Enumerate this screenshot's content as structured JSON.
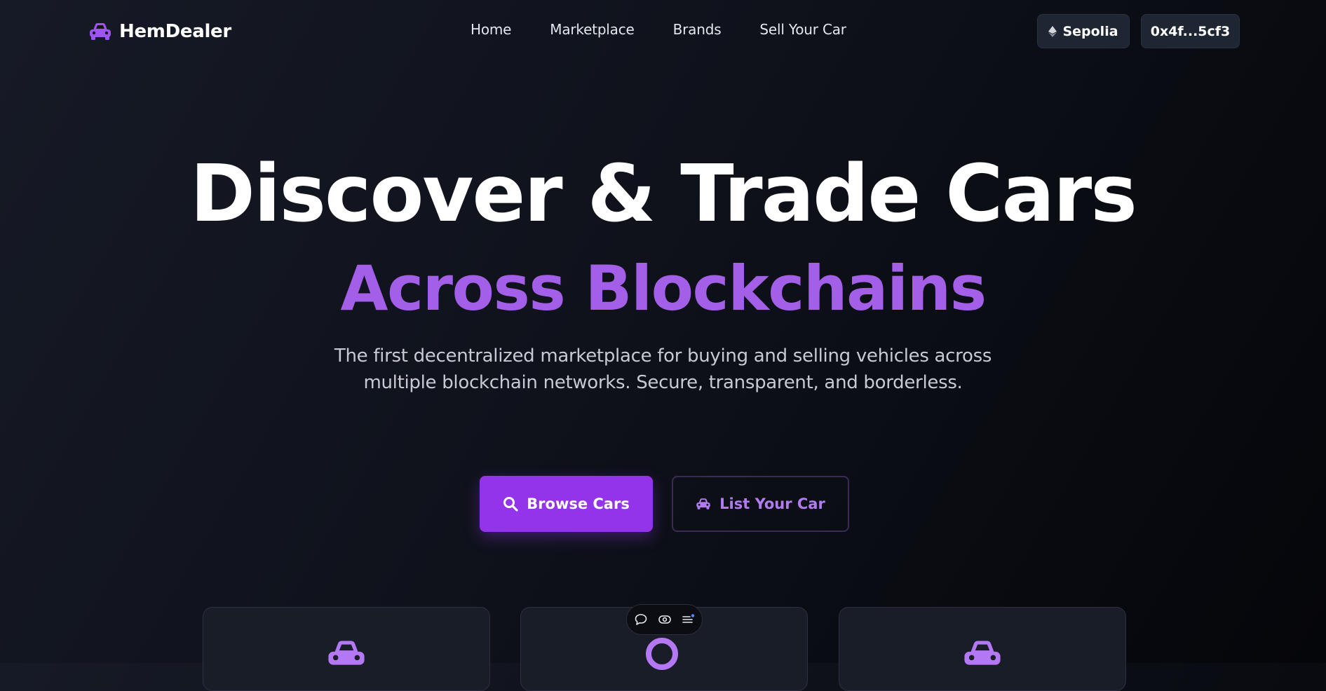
{
  "header": {
    "brand_name": "HemDealer",
    "nav": [
      "Home",
      "Marketplace",
      "Brands",
      "Sell Your Car"
    ],
    "network_label": "Sepolia",
    "wallet_address": "0x4f...5cf3"
  },
  "hero": {
    "title": "Discover & Trade Cars",
    "subtitle": "Across Blockchains",
    "description": "The first decentralized marketplace for buying and selling vehicles across multiple blockchain networks. Secure, transparent, and borderless.",
    "primary_button": "Browse Cars",
    "secondary_button": "List Your Car"
  },
  "features": {
    "cards": [
      {
        "icon": "car-icon"
      },
      {
        "icon": "ring-icon"
      },
      {
        "icon": "car-icon"
      }
    ]
  },
  "toolbar": {
    "icons": [
      "comment-icon",
      "eye-icon",
      "list-icon"
    ]
  },
  "colors": {
    "accent": "#9333ea",
    "accent_text": "#a45fe9",
    "background": "#0f121b",
    "pill_bg": "#1e2533"
  }
}
